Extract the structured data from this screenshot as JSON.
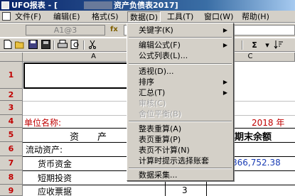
{
  "window": {
    "title_prefix": "UFO报表 - [",
    "title_suffix": "资产负债表2017]"
  },
  "menubar": {
    "items": [
      {
        "label": "文件(F)"
      },
      {
        "label": "编辑(E)"
      },
      {
        "label": "格式(S)"
      },
      {
        "label": "数据(D)"
      },
      {
        "label": "工具(T)"
      },
      {
        "label": "窗口(W)"
      },
      {
        "label": "帮助(H)"
      }
    ]
  },
  "cellbar": {
    "cell_ref": "A1@3",
    "fx_label": "fx"
  },
  "toolbar": {
    "icons": [
      "new-icon",
      "open-icon",
      "save-icon",
      "save-as-icon",
      "print-icon",
      "print-preview-icon",
      "cut-icon",
      "sum-icon",
      "sort-icon"
    ],
    "sum_glyph": "Σ"
  },
  "grid": {
    "columns": [
      "A",
      "B",
      "C"
    ],
    "rows": [
      "1",
      "2",
      "3",
      "4",
      "5",
      "6",
      "7",
      "8",
      "9"
    ],
    "cells": {
      "r4_unit": "单位名称:",
      "r4_year": "2018 年",
      "r5_asset": "资　　产",
      "r5_end_balance": "期末余额",
      "r6_current_assets": "流动资产:",
      "r7_cash": "货币资金",
      "r7_amount": "866,752.38",
      "r8_short_invest": "短期投资",
      "r9_notes": "应收票据",
      "r9_line": "3"
    }
  },
  "colors": {
    "red_text": "#c00000",
    "blue_text": "#1a3cb4",
    "menu_bg": "#d4d0c8"
  },
  "dropdown": {
    "items": [
      {
        "label": "关键字(K)",
        "submenu": true,
        "disabled": false
      },
      {
        "label": "编辑公式(F)",
        "submenu": true,
        "disabled": false
      },
      {
        "label": "公式列表(L)...",
        "submenu": false,
        "disabled": false
      },
      {
        "label": "透视(D)...",
        "submenu": false,
        "disabled": false
      },
      {
        "label": "排序",
        "submenu": true,
        "disabled": false
      },
      {
        "label": "汇总(T)",
        "submenu": true,
        "disabled": false
      },
      {
        "label": "审核(C)",
        "submenu": false,
        "disabled": true
      },
      {
        "label": "舍位平衡(B)",
        "submenu": false,
        "disabled": true
      },
      {
        "label": "整表重算(A)",
        "submenu": false,
        "disabled": false
      },
      {
        "label": "表页重算(P)",
        "submenu": false,
        "disabled": false
      },
      {
        "label": "表页不计算(N)",
        "submenu": false,
        "disabled": false
      },
      {
        "label": "计算时提示选择账套",
        "submenu": false,
        "disabled": false
      },
      {
        "label": "数据采集...",
        "submenu": false,
        "disabled": false
      }
    ]
  }
}
